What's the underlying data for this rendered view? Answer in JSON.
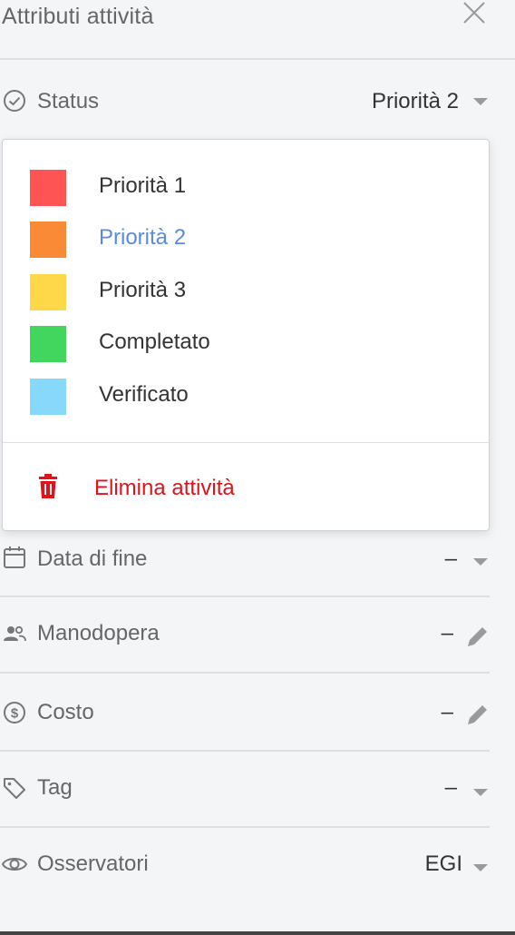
{
  "panel": {
    "title": "Attributi attività",
    "close_icon": "close-icon"
  },
  "status": {
    "label": "Status",
    "value": "Priorità 2",
    "icon": "check-circle-icon"
  },
  "status_dropdown": {
    "options": [
      {
        "label": "Priorità 1",
        "color": "#ff5453",
        "selected": false
      },
      {
        "label": "Priorità 2",
        "color": "#fb8a36",
        "selected": true
      },
      {
        "label": "Priorità 3",
        "color": "#ffd84a",
        "selected": false
      },
      {
        "label": "Completato",
        "color": "#43d65f",
        "selected": false
      },
      {
        "label": "Verificato",
        "color": "#87d8fb",
        "selected": false
      }
    ],
    "delete_label": "Elimina attività",
    "delete_color": "#e0131b"
  },
  "fields": [
    {
      "label": "Data di fine",
      "value": "–",
      "icon": "calendar-icon",
      "action": "caret"
    },
    {
      "label": "Manodopera",
      "value": "–",
      "icon": "people-icon",
      "action": "pencil"
    },
    {
      "label": "Costo",
      "value": "–",
      "icon": "dollar-circle-icon",
      "action": "pencil"
    },
    {
      "label": "Tag",
      "value": "–",
      "icon": "tag-icon",
      "action": "caret"
    },
    {
      "label": "Osservatori",
      "value": "EGI",
      "icon": "eye-icon",
      "action": "caret"
    }
  ],
  "colors": {
    "accent": "#5b8be0",
    "danger": "#e0131b",
    "background": "#f4f5f7"
  }
}
